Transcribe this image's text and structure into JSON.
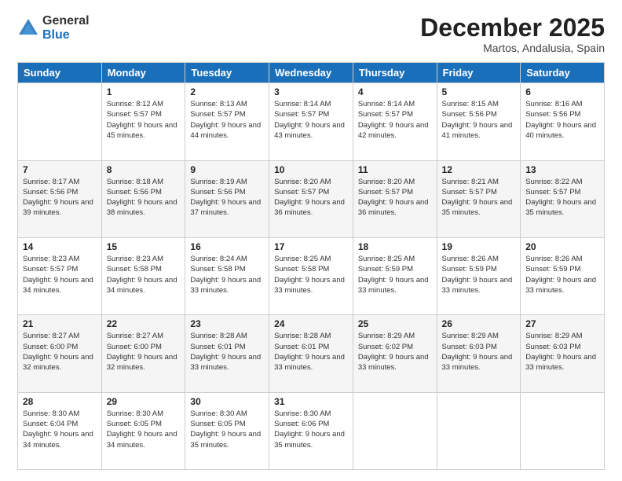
{
  "logo": {
    "general": "General",
    "blue": "Blue"
  },
  "header": {
    "month": "December 2025",
    "location": "Martos, Andalusia, Spain"
  },
  "weekdays": [
    "Sunday",
    "Monday",
    "Tuesday",
    "Wednesday",
    "Thursday",
    "Friday",
    "Saturday"
  ],
  "weeks": [
    [
      {
        "day": "",
        "sunrise": "",
        "sunset": "",
        "daylight": ""
      },
      {
        "day": "1",
        "sunrise": "Sunrise: 8:12 AM",
        "sunset": "Sunset: 5:57 PM",
        "daylight": "Daylight: 9 hours and 45 minutes."
      },
      {
        "day": "2",
        "sunrise": "Sunrise: 8:13 AM",
        "sunset": "Sunset: 5:57 PM",
        "daylight": "Daylight: 9 hours and 44 minutes."
      },
      {
        "day": "3",
        "sunrise": "Sunrise: 8:14 AM",
        "sunset": "Sunset: 5:57 PM",
        "daylight": "Daylight: 9 hours and 43 minutes."
      },
      {
        "day": "4",
        "sunrise": "Sunrise: 8:14 AM",
        "sunset": "Sunset: 5:57 PM",
        "daylight": "Daylight: 9 hours and 42 minutes."
      },
      {
        "day": "5",
        "sunrise": "Sunrise: 8:15 AM",
        "sunset": "Sunset: 5:56 PM",
        "daylight": "Daylight: 9 hours and 41 minutes."
      },
      {
        "day": "6",
        "sunrise": "Sunrise: 8:16 AM",
        "sunset": "Sunset: 5:56 PM",
        "daylight": "Daylight: 9 hours and 40 minutes."
      }
    ],
    [
      {
        "day": "7",
        "sunrise": "Sunrise: 8:17 AM",
        "sunset": "Sunset: 5:56 PM",
        "daylight": "Daylight: 9 hours and 39 minutes."
      },
      {
        "day": "8",
        "sunrise": "Sunrise: 8:18 AM",
        "sunset": "Sunset: 5:56 PM",
        "daylight": "Daylight: 9 hours and 38 minutes."
      },
      {
        "day": "9",
        "sunrise": "Sunrise: 8:19 AM",
        "sunset": "Sunset: 5:56 PM",
        "daylight": "Daylight: 9 hours and 37 minutes."
      },
      {
        "day": "10",
        "sunrise": "Sunrise: 8:20 AM",
        "sunset": "Sunset: 5:57 PM",
        "daylight": "Daylight: 9 hours and 36 minutes."
      },
      {
        "day": "11",
        "sunrise": "Sunrise: 8:20 AM",
        "sunset": "Sunset: 5:57 PM",
        "daylight": "Daylight: 9 hours and 36 minutes."
      },
      {
        "day": "12",
        "sunrise": "Sunrise: 8:21 AM",
        "sunset": "Sunset: 5:57 PM",
        "daylight": "Daylight: 9 hours and 35 minutes."
      },
      {
        "day": "13",
        "sunrise": "Sunrise: 8:22 AM",
        "sunset": "Sunset: 5:57 PM",
        "daylight": "Daylight: 9 hours and 35 minutes."
      }
    ],
    [
      {
        "day": "14",
        "sunrise": "Sunrise: 8:23 AM",
        "sunset": "Sunset: 5:57 PM",
        "daylight": "Daylight: 9 hours and 34 minutes."
      },
      {
        "day": "15",
        "sunrise": "Sunrise: 8:23 AM",
        "sunset": "Sunset: 5:58 PM",
        "daylight": "Daylight: 9 hours and 34 minutes."
      },
      {
        "day": "16",
        "sunrise": "Sunrise: 8:24 AM",
        "sunset": "Sunset: 5:58 PM",
        "daylight": "Daylight: 9 hours and 33 minutes."
      },
      {
        "day": "17",
        "sunrise": "Sunrise: 8:25 AM",
        "sunset": "Sunset: 5:58 PM",
        "daylight": "Daylight: 9 hours and 33 minutes."
      },
      {
        "day": "18",
        "sunrise": "Sunrise: 8:25 AM",
        "sunset": "Sunset: 5:59 PM",
        "daylight": "Daylight: 9 hours and 33 minutes."
      },
      {
        "day": "19",
        "sunrise": "Sunrise: 8:26 AM",
        "sunset": "Sunset: 5:59 PM",
        "daylight": "Daylight: 9 hours and 33 minutes."
      },
      {
        "day": "20",
        "sunrise": "Sunrise: 8:26 AM",
        "sunset": "Sunset: 5:59 PM",
        "daylight": "Daylight: 9 hours and 33 minutes."
      }
    ],
    [
      {
        "day": "21",
        "sunrise": "Sunrise: 8:27 AM",
        "sunset": "Sunset: 6:00 PM",
        "daylight": "Daylight: 9 hours and 32 minutes."
      },
      {
        "day": "22",
        "sunrise": "Sunrise: 8:27 AM",
        "sunset": "Sunset: 6:00 PM",
        "daylight": "Daylight: 9 hours and 32 minutes."
      },
      {
        "day": "23",
        "sunrise": "Sunrise: 8:28 AM",
        "sunset": "Sunset: 6:01 PM",
        "daylight": "Daylight: 9 hours and 33 minutes."
      },
      {
        "day": "24",
        "sunrise": "Sunrise: 8:28 AM",
        "sunset": "Sunset: 6:01 PM",
        "daylight": "Daylight: 9 hours and 33 minutes."
      },
      {
        "day": "25",
        "sunrise": "Sunrise: 8:29 AM",
        "sunset": "Sunset: 6:02 PM",
        "daylight": "Daylight: 9 hours and 33 minutes."
      },
      {
        "day": "26",
        "sunrise": "Sunrise: 8:29 AM",
        "sunset": "Sunset: 6:03 PM",
        "daylight": "Daylight: 9 hours and 33 minutes."
      },
      {
        "day": "27",
        "sunrise": "Sunrise: 8:29 AM",
        "sunset": "Sunset: 6:03 PM",
        "daylight": "Daylight: 9 hours and 33 minutes."
      }
    ],
    [
      {
        "day": "28",
        "sunrise": "Sunrise: 8:30 AM",
        "sunset": "Sunset: 6:04 PM",
        "daylight": "Daylight: 9 hours and 34 minutes."
      },
      {
        "day": "29",
        "sunrise": "Sunrise: 8:30 AM",
        "sunset": "Sunset: 6:05 PM",
        "daylight": "Daylight: 9 hours and 34 minutes."
      },
      {
        "day": "30",
        "sunrise": "Sunrise: 8:30 AM",
        "sunset": "Sunset: 6:05 PM",
        "daylight": "Daylight: 9 hours and 35 minutes."
      },
      {
        "day": "31",
        "sunrise": "Sunrise: 8:30 AM",
        "sunset": "Sunset: 6:06 PM",
        "daylight": "Daylight: 9 hours and 35 minutes."
      },
      {
        "day": "",
        "sunrise": "",
        "sunset": "",
        "daylight": ""
      },
      {
        "day": "",
        "sunrise": "",
        "sunset": "",
        "daylight": ""
      },
      {
        "day": "",
        "sunrise": "",
        "sunset": "",
        "daylight": ""
      }
    ]
  ]
}
